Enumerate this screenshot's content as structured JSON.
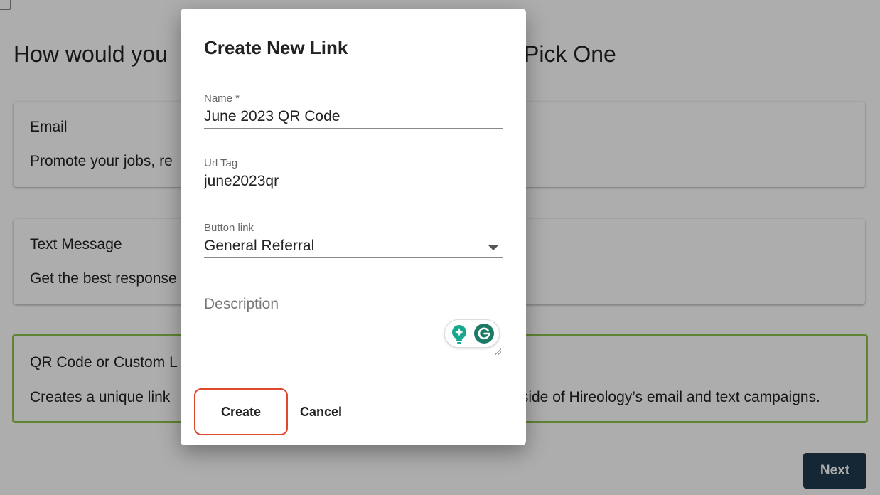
{
  "page": {
    "title_left": "How would you",
    "title_right": "Pick One",
    "options": [
      {
        "title": "Email",
        "description_left": "Promote your jobs, re",
        "description_right": ""
      },
      {
        "title": "Text Message",
        "description_left": "Get the best response",
        "description_right": ""
      },
      {
        "title": "QR Code or Custom L",
        "description_left": "Creates a unique link",
        "description_right": "tside of Hireology’s email and text campaigns."
      }
    ],
    "next_label": "Next"
  },
  "dialog": {
    "title": "Create New Link",
    "name": {
      "label": "Name *",
      "value": "June 2023 QR Code"
    },
    "url_tag": {
      "label": "Url Tag",
      "value": "june2023qr"
    },
    "button_link": {
      "label": "Button link",
      "value": "General Referral"
    },
    "description": {
      "placeholder": "Description",
      "value": ""
    },
    "create_label": "Create",
    "cancel_label": "Cancel"
  },
  "colors": {
    "selected_border": "#8cc34a",
    "next_button": "#1f3a4d",
    "create_highlight": "#e0482e",
    "grammarly_green": "#15a88c"
  },
  "icons": {
    "dropdown": "chevron-down-icon",
    "assist": "lightbulb-icon",
    "grammarly": "grammarly-icon"
  }
}
